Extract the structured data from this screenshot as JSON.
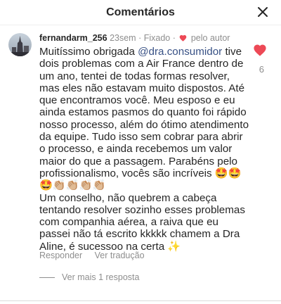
{
  "header": {
    "title": "Comentários"
  },
  "comment": {
    "username": "fernandarm_256",
    "time": "23sem",
    "pinned": "· Fixado ·",
    "liked_by_author": "pelo autor",
    "text_before_mention": "Muitíssimo obrigada ",
    "mention": "@dra.consumidor",
    "text_after_mention": " tive dois problemas com a Air France dentro de um ano, tentei de todas formas resolver, mas eles não estavam muito dispostos. Até que encontramos você. Meu esposo e eu ainda estamos pasmos do quanto foi rápido nosso processo, além do ótimo atendimento da equipe. Tudo isso sem cobrar para abrir o processo, e ainda recebemos um valor maior do que a passagem. Parabéns pelo profissionalismo, vocês são incríveis 🤩🤩🤩👏🏼👏🏼👏🏼👏🏼",
    "text_end": "Um conselho, não quebrem a cabeça tentando resolver sozinho esses problemas com companhia aérea, a raiva que eu passei não tá escrito kkkkk chamem a Dra Aline, é sucessoo na certa ✨",
    "like_count": "6",
    "reply_label": "Responder",
    "translate_label": "Ver tradução",
    "view_replies_label": "Ver mais 1 resposta"
  },
  "colors": {
    "heart": "#ed4956",
    "mention": "#385185",
    "muted": "#8e8e8e"
  }
}
